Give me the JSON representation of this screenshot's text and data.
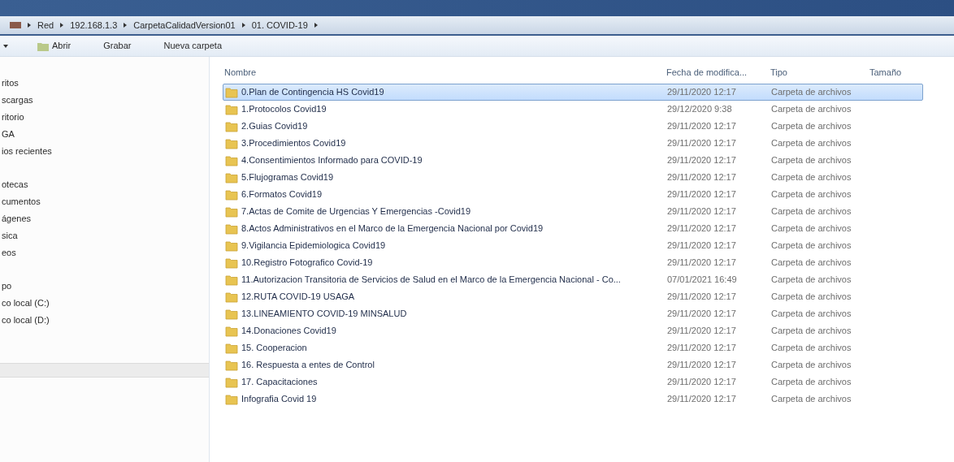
{
  "address_bar": {
    "crumbs": [
      "Red",
      "192.168.1.3",
      "CarpetaCalidadVersion01",
      "01. COVID-19"
    ]
  },
  "toolbar": {
    "buttons": [
      "Abrir",
      "Grabar",
      "Nueva carpeta"
    ]
  },
  "sidebar": {
    "groups": [
      {
        "items": [
          {
            "label": "ritos"
          },
          {
            "label": "scargas"
          },
          {
            "label": "ritorio"
          },
          {
            "label": "GA"
          },
          {
            "label": "ios recientes"
          }
        ]
      },
      {
        "items": [
          {
            "label": "otecas"
          },
          {
            "label": "cumentos"
          },
          {
            "label": "ágenes"
          },
          {
            "label": "sica"
          },
          {
            "label": "eos"
          }
        ]
      },
      {
        "items": [
          {
            "label": "po"
          },
          {
            "label": "co local (C:)"
          },
          {
            "label": "co local (D:)"
          }
        ]
      }
    ]
  },
  "table": {
    "columns": [
      "Nombre",
      "Fecha de modifica...",
      "Tipo",
      "Tamaño"
    ],
    "rows": [
      {
        "name": "0.Plan de Contingencia HS Covid19",
        "date": "29/11/2020 12:17",
        "type": "Carpeta de archivos",
        "selected": true
      },
      {
        "name": "1.Protocolos Covid19",
        "date": "29/12/2020 9:38",
        "type": "Carpeta de archivos",
        "selected": false
      },
      {
        "name": "2.Guias Covid19",
        "date": "29/11/2020 12:17",
        "type": "Carpeta de archivos",
        "selected": false
      },
      {
        "name": "3.Procedimientos Covid19",
        "date": "29/11/2020 12:17",
        "type": "Carpeta de archivos",
        "selected": false
      },
      {
        "name": "4.Consentimientos Informado para COVID-19",
        "date": "29/11/2020 12:17",
        "type": "Carpeta de archivos",
        "selected": false
      },
      {
        "name": "5.Flujogramas Covid19",
        "date": "29/11/2020 12:17",
        "type": "Carpeta de archivos",
        "selected": false
      },
      {
        "name": "6.Formatos Covid19",
        "date": "29/11/2020 12:17",
        "type": "Carpeta de archivos",
        "selected": false
      },
      {
        "name": "7.Actas de Comite de Urgencias Y Emergencias -Covid19",
        "date": "29/11/2020 12:17",
        "type": "Carpeta de archivos",
        "selected": false
      },
      {
        "name": "8.Actos Administrativos en el Marco de la Emergencia Nacional por Covid19",
        "date": "29/11/2020 12:17",
        "type": "Carpeta de archivos",
        "selected": false
      },
      {
        "name": "9.Vigilancia Epidemiologica Covid19",
        "date": "29/11/2020 12:17",
        "type": "Carpeta de archivos",
        "selected": false
      },
      {
        "name": "10.Registro Fotografico Covid-19",
        "date": "29/11/2020 12:17",
        "type": "Carpeta de archivos",
        "selected": false
      },
      {
        "name": "11.Autorizacion Transitoria de Servicios de Salud en el Marco de la Emergencia Nacional - Co...",
        "date": "07/01/2021 16:49",
        "type": "Carpeta de archivos",
        "selected": false
      },
      {
        "name": "12.RUTA COVID-19 USAGA",
        "date": "29/11/2020 12:17",
        "type": "Carpeta de archivos",
        "selected": false
      },
      {
        "name": "13.LINEAMIENTO COVID-19 MINSALUD",
        "date": "29/11/2020 12:17",
        "type": "Carpeta de archivos",
        "selected": false
      },
      {
        "name": "14.Donaciones Covid19",
        "date": "29/11/2020 12:17",
        "type": "Carpeta de archivos",
        "selected": false
      },
      {
        "name": "15. Cooperacion",
        "date": "29/11/2020 12:17",
        "type": "Carpeta de archivos",
        "selected": false
      },
      {
        "name": "16. Respuesta a entes de Control",
        "date": "29/11/2020 12:17",
        "type": "Carpeta de archivos",
        "selected": false
      },
      {
        "name": "17. Capacitaciones",
        "date": "29/11/2020 12:17",
        "type": "Carpeta de archivos",
        "selected": false
      },
      {
        "name": "Infografia Covid 19",
        "date": "29/11/2020 12:17",
        "type": "Carpeta de archivos",
        "selected": false
      }
    ]
  }
}
